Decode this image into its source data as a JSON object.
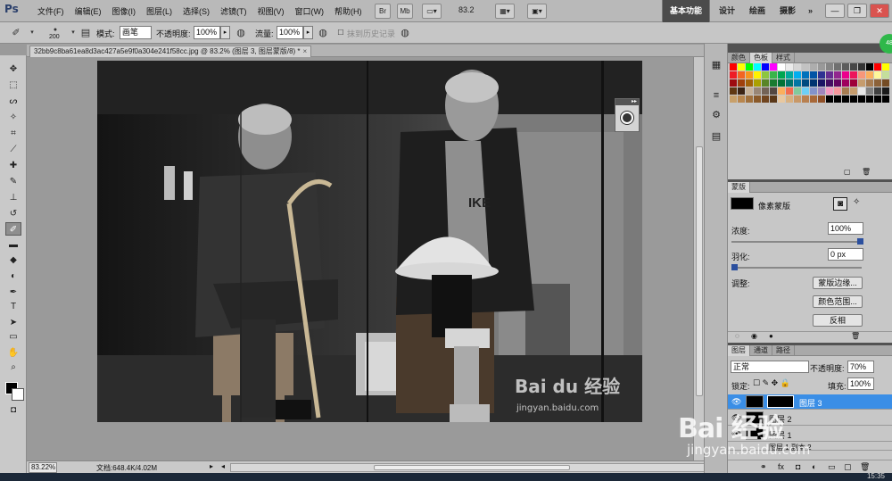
{
  "app": {
    "logo": "Ps",
    "menu": [
      "文件(F)",
      "编辑(E)",
      "图像(I)",
      "图层(L)",
      "选择(S)",
      "滤镜(T)",
      "视图(V)",
      "窗口(W)",
      "帮助(H)"
    ],
    "bridge_btn": "Br",
    "minibridge_btn": "Mb",
    "zoom_level": "83.2",
    "workspaces": [
      "基本功能",
      "设计",
      "绘画",
      "摄影"
    ],
    "more": "»",
    "window_controls": [
      "—",
      "❐",
      "✕"
    ]
  },
  "options": {
    "brush_size": "200",
    "mode_label": "模式:",
    "mode_value": "画笔",
    "opacity_label": "不透明度:",
    "opacity_value": "100%",
    "flow_label": "流量:",
    "flow_value": "100%",
    "history_label": "抹到历史记录"
  },
  "document": {
    "tab_title": "32bb9c8ba61ea8d3ac427a5e9f0a304e241f58cc.jpg @ 83.2% (图层 3, 图层蒙版/8) *",
    "close": "×"
  },
  "status": {
    "zoom": "83.22%",
    "doc_info": "文档:648.4K/4.02M"
  },
  "photo_watermark": {
    "logo": "Bai du 经验",
    "url": "jingyan.baidu.com",
    "shirt_text": "IKE"
  },
  "panels": {
    "swatch_tabs": [
      "颜色",
      "色板",
      "样式"
    ],
    "mask_tab": "蒙版",
    "mask_title": "像素蒙版",
    "density_label": "浓度:",
    "density_value": "100%",
    "feather_label": "羽化:",
    "feather_value": "0 px",
    "refine_label": "调整:",
    "btn_edge": "蒙版边缘...",
    "btn_color": "颜色范围...",
    "btn_invert": "反相",
    "layer_tabs": [
      "图层",
      "通道",
      "路径"
    ],
    "blend_mode": "正常",
    "layer_opacity_label": "不透明度:",
    "layer_opacity_value": "70%",
    "lock_label": "锁定:",
    "fill_label": "填充:",
    "fill_value": "100%",
    "layers": [
      "图层 3",
      "图层 2",
      "图层 1",
      "图层 1 副本 2"
    ]
  },
  "screen_watermark": {
    "logo": "Bai 经验",
    "url": "jingyan.baidu.com"
  },
  "badge": "48",
  "taskbar": {
    "clock": "15:35"
  },
  "swatches": [
    [
      "#ff0000",
      "#ffff00",
      "#00ff00",
      "#00ffff",
      "#0000ff",
      "#ff00ff",
      "#ffffff",
      "#ebebeb",
      "#d6d6d6",
      "#c2c2c2",
      "#adadad",
      "#999999",
      "#858585",
      "#707070",
      "#5c5c5c",
      "#474747",
      "#333333",
      "#000000",
      "#ff0000",
      "#ffff00"
    ],
    [
      "#ee1c25",
      "#f26522",
      "#f7941d",
      "#fff200",
      "#8dc63f",
      "#39b54a",
      "#00a651",
      "#00a99d",
      "#00aeef",
      "#0072bc",
      "#0054a6",
      "#2e3192",
      "#662d91",
      "#92278f",
      "#ec008c",
      "#ed145b",
      "#f7977a",
      "#fbaf5d",
      "#fff79a",
      "#c4df9b"
    ],
    [
      "#9e0b0f",
      "#a0410d",
      "#a36209",
      "#aba000",
      "#598527",
      "#197b30",
      "#007236",
      "#00746b",
      "#0076a3",
      "#004b80",
      "#003471",
      "#1b1464",
      "#440e62",
      "#630460",
      "#9e005d",
      "#9e0039",
      "#c69c6d",
      "#a67c52",
      "#8c6239",
      "#754c24"
    ],
    [
      "#603813",
      "#3c2415",
      "#c7b299",
      "#998675",
      "#736357",
      "#534741",
      "#fbaf5d",
      "#f26c4f",
      "#82ca9c",
      "#6dcff6",
      "#8393ca",
      "#a186be",
      "#f49ac2",
      "#f6989d",
      "#a67c52",
      "#c69c6d",
      "#e6e6e6",
      "#808080",
      "#404040",
      "#1a1a1a"
    ],
    [
      "#c8a06a",
      "#b8864e",
      "#a0703c",
      "#8a5a2a",
      "#704520",
      "#5a3818",
      "#e8c8a0",
      "#d8b080",
      "#c89868",
      "#b88050",
      "#a86838",
      "#905028",
      "#000000",
      "#000000",
      "#000000",
      "#000000",
      "#000000",
      "#000000",
      "#000000",
      "#000000"
    ]
  ]
}
